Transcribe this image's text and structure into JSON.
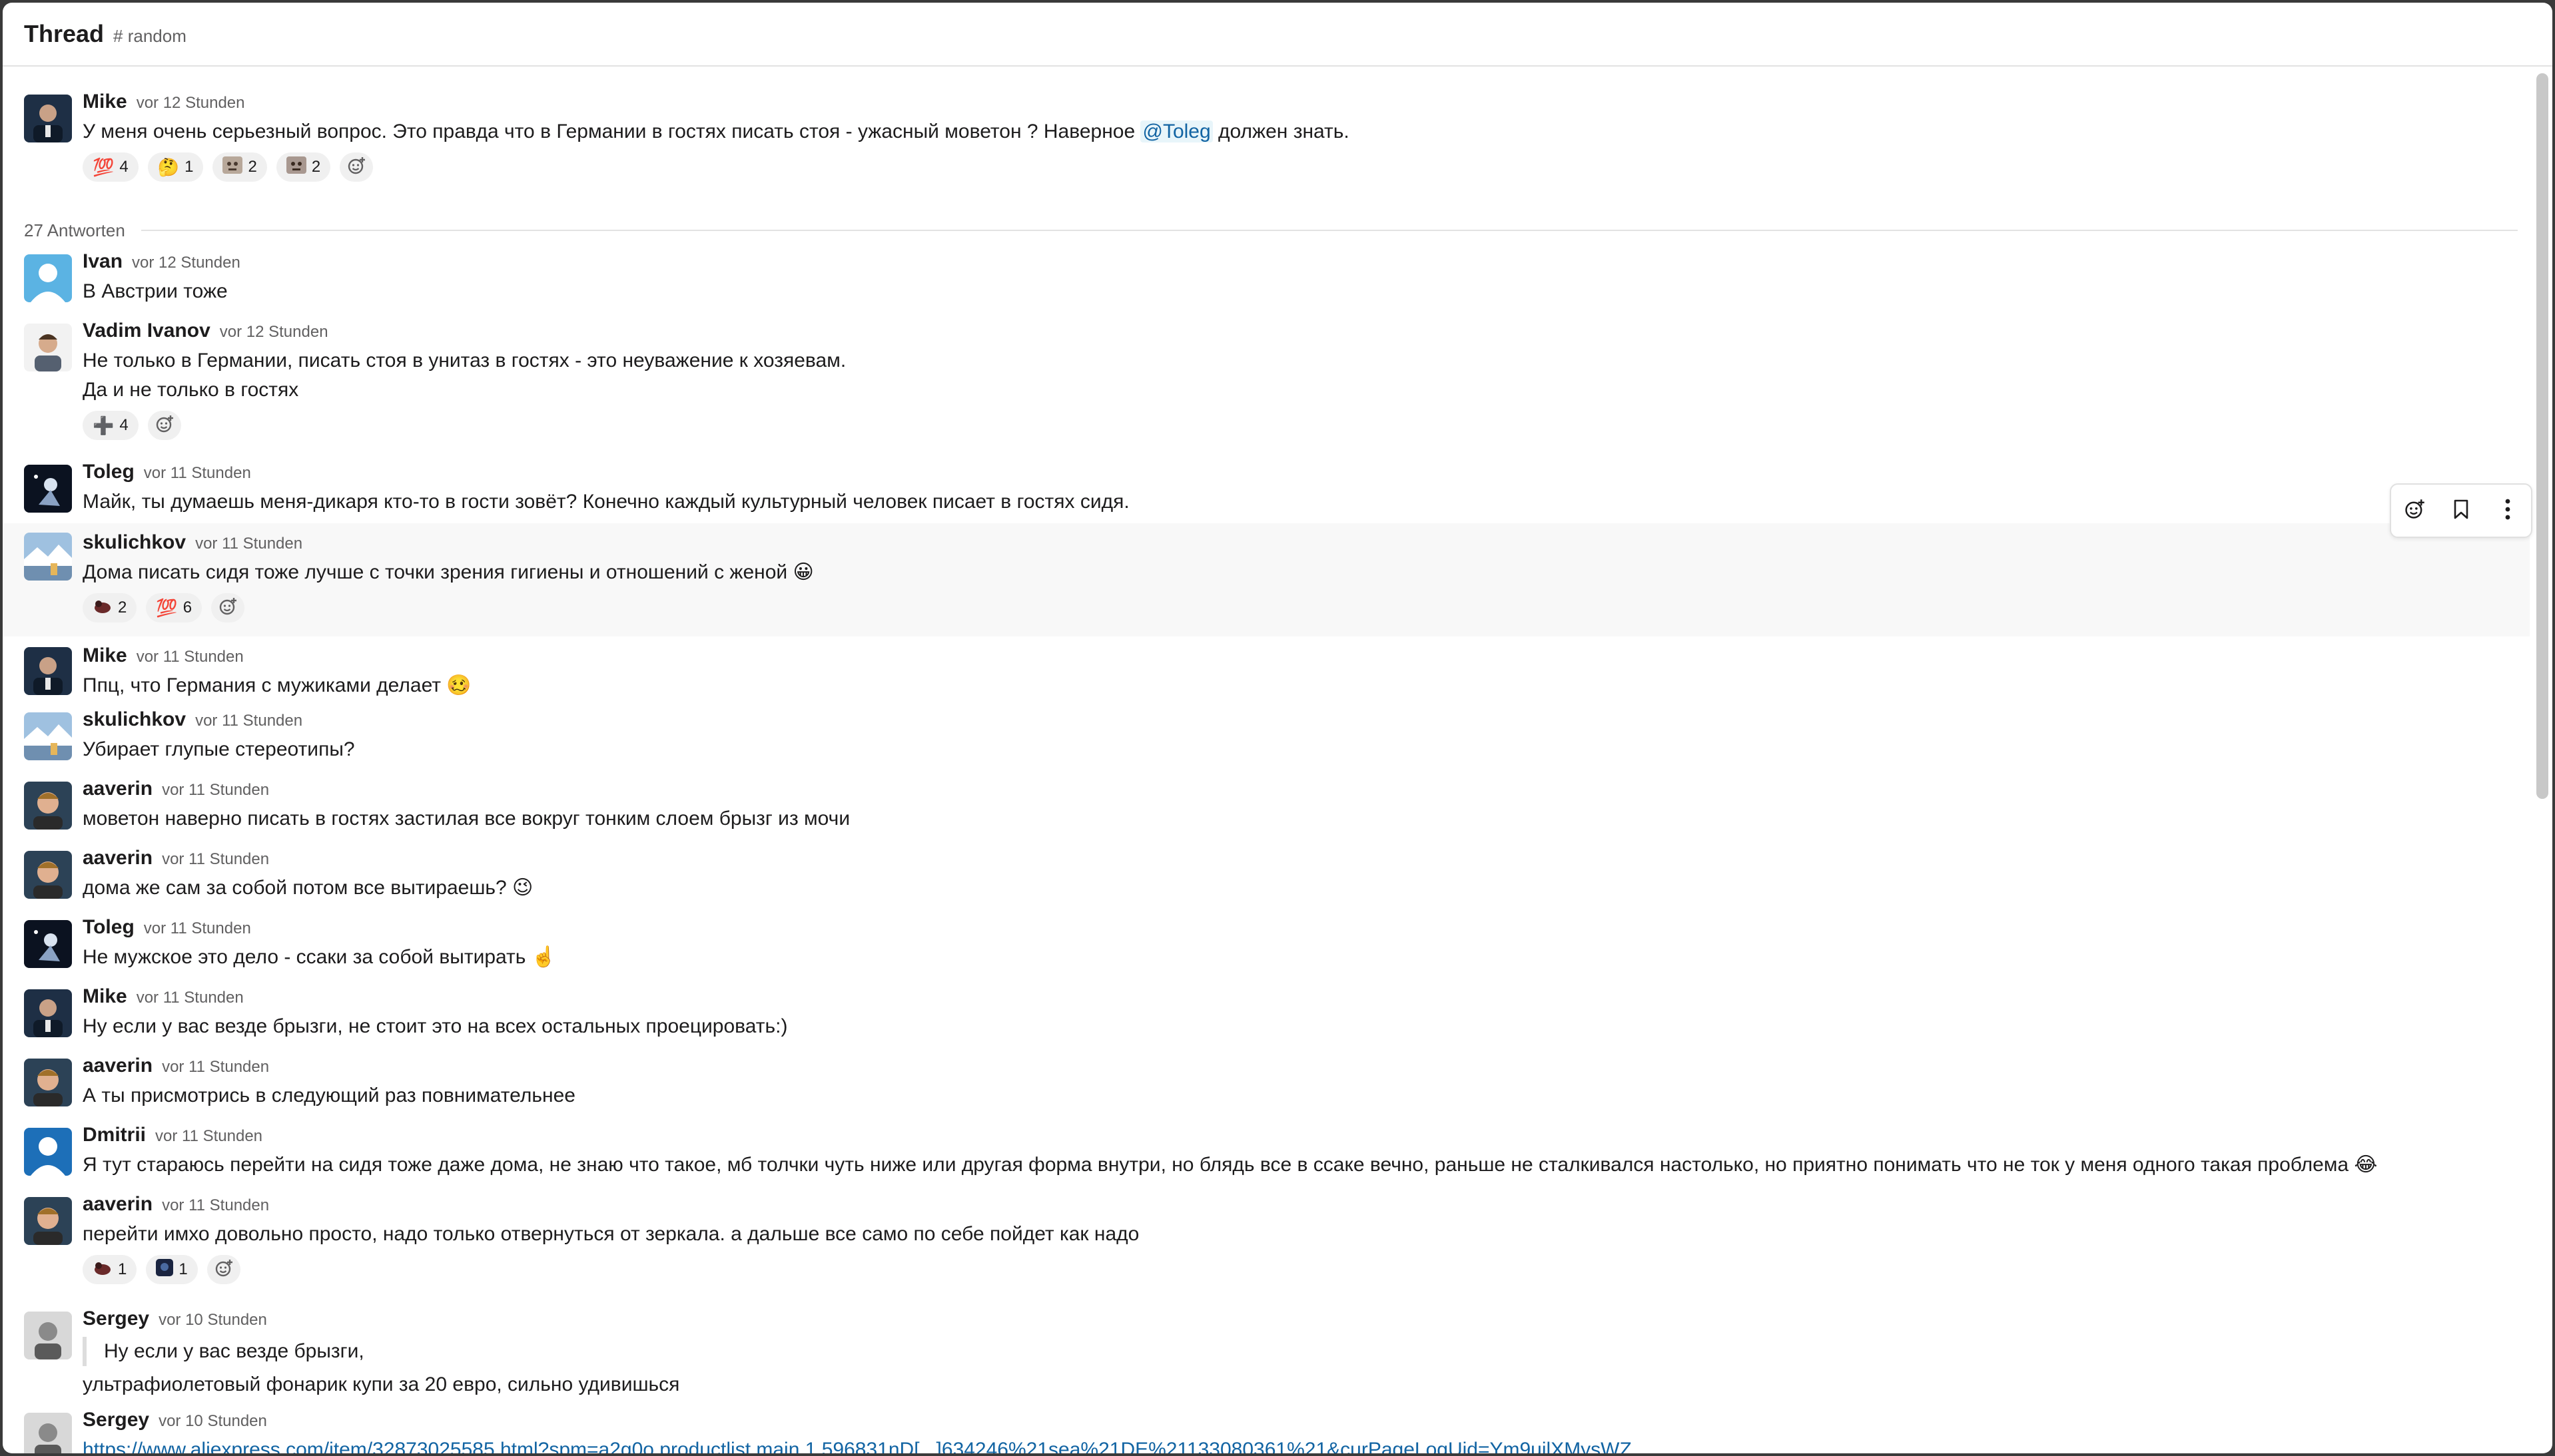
{
  "header": {
    "title": "Thread",
    "channel": "# random"
  },
  "thread": {
    "parent": {
      "author": "Mike",
      "time": "vor 12 Stunden",
      "text_before": "У меня очень серьезный вопрос. Это правда что в Германии в гостях писать стоя - ужасный моветон ? Наверное ",
      "mention": "@Toleg",
      "text_after": " должен знать.",
      "reactions": [
        {
          "emoji": "💯",
          "count": "4"
        },
        {
          "emoji": "🤔",
          "count": "1"
        },
        {
          "emoji": "custom-emoji-face",
          "count": "2"
        },
        {
          "emoji": "custom-emoji-face",
          "count": "2"
        }
      ]
    },
    "replies_count": "27 Antworten",
    "messages": [
      {
        "author": "Ivan",
        "time": "vor 12 Stunden",
        "lines": [
          "В Австрии тоже"
        ]
      },
      {
        "author": "Vadim Ivanov",
        "time": "vor 12 Stunden",
        "lines": [
          "Не только в Германии, писать стоя в унитаз в гостях - это неуважение к хозяевам.",
          "Да и не только в гостях"
        ],
        "reactions": [
          {
            "emoji": "➕",
            "count": "4"
          }
        ]
      },
      {
        "author": "Toleg",
        "time": "vor 11 Stunden",
        "lines": [
          "Майк, ты думаешь меня-дикаря кто-то в гости зовёт? Конечно каждый культурный человек писает в гостях сидя."
        ]
      },
      {
        "author": "skulichkov",
        "time": "vor 11 Stunden",
        "lines": [
          "Дома писать сидя тоже лучше с точки зрения гигиены и отношений с женой 😀"
        ],
        "reactions": [
          {
            "emoji": "custom-emoji-bird",
            "count": "2"
          },
          {
            "emoji": "💯",
            "count": "6"
          }
        ]
      },
      {
        "author": "Mike",
        "time": "vor 11 Stunden",
        "lines": [
          "Ппц, что Германия с мужиками делает 🥴"
        ]
      },
      {
        "author": "skulichkov",
        "time": "vor 11 Stunden",
        "lines": [
          "Убирает глупые стереотипы?"
        ]
      },
      {
        "author": "aaverin",
        "time": "vor 11 Stunden",
        "lines": [
          "моветон наверно писать в гостях застилая все вокруг тонким слоем брызг из мочи"
        ]
      },
      {
        "author": "aaverin",
        "time": "vor 11 Stunden",
        "lines": [
          "дома же сам за собой потом все вытираешь? 😉"
        ]
      },
      {
        "author": "Toleg",
        "time": "vor 11 Stunden",
        "lines": [
          "Не мужское это дело - ссаки за собой вытирать ☝️"
        ]
      },
      {
        "author": "Mike",
        "time": "vor 11 Stunden",
        "lines": [
          "Ну если у вас везде брызги, не стоит это на всех остальных проецировать:)"
        ]
      },
      {
        "author": "aaverin",
        "time": "vor 11 Stunden",
        "lines": [
          "А ты присмотрись в следующий раз повнимательнее"
        ]
      },
      {
        "author": "Dmitrii",
        "time": "vor 11 Stunden",
        "lines": [
          "Я тут стараюсь перейти на сидя тоже даже дома, не знаю что такое, мб толчки чуть ниже или другая форма внутри, но блядь все в ссаке вечно, раньше не сталкивался настолько, но приятно понимать что не ток у меня одного такая проблема 😂"
        ]
      },
      {
        "author": "aaverin",
        "time": "vor 11 Stunden",
        "lines": [
          "перейти имхо довольно просто, надо только отвернуться от зеркала. а дальше все само по себе пойдет как надо"
        ],
        "reactions": [
          {
            "emoji": "custom-emoji-bird",
            "count": "1"
          },
          {
            "emoji": "custom-emoji-dark",
            "count": "1"
          }
        ]
      },
      {
        "author": "Sergey",
        "time": "vor 10 Stunden",
        "quote": "Ну если у вас везде брызги,",
        "lines": [
          "ультрафиолетовый фонарик купи за 20 евро, сильно удивишься"
        ]
      },
      {
        "author": "Sergey",
        "time": "vor 10 Stunden",
        "link": "https://www.aliexpress.com/item/32873025585.html?spm=a2g0o.productlist.main.1.596831nD[...]634246%21sea%21DE%21133080361%21&curPageLogUid=Ym9uilXMysWZ"
      }
    ]
  },
  "toolbar": {
    "icons": [
      "add-reaction-icon",
      "bookmark-icon",
      "more-options-icon"
    ]
  },
  "colors": {
    "mention": "#1264a3",
    "link": "#1264a3",
    "reaction_bg": "#f0f0f0",
    "highlight_bg": "#f8f8f8"
  }
}
